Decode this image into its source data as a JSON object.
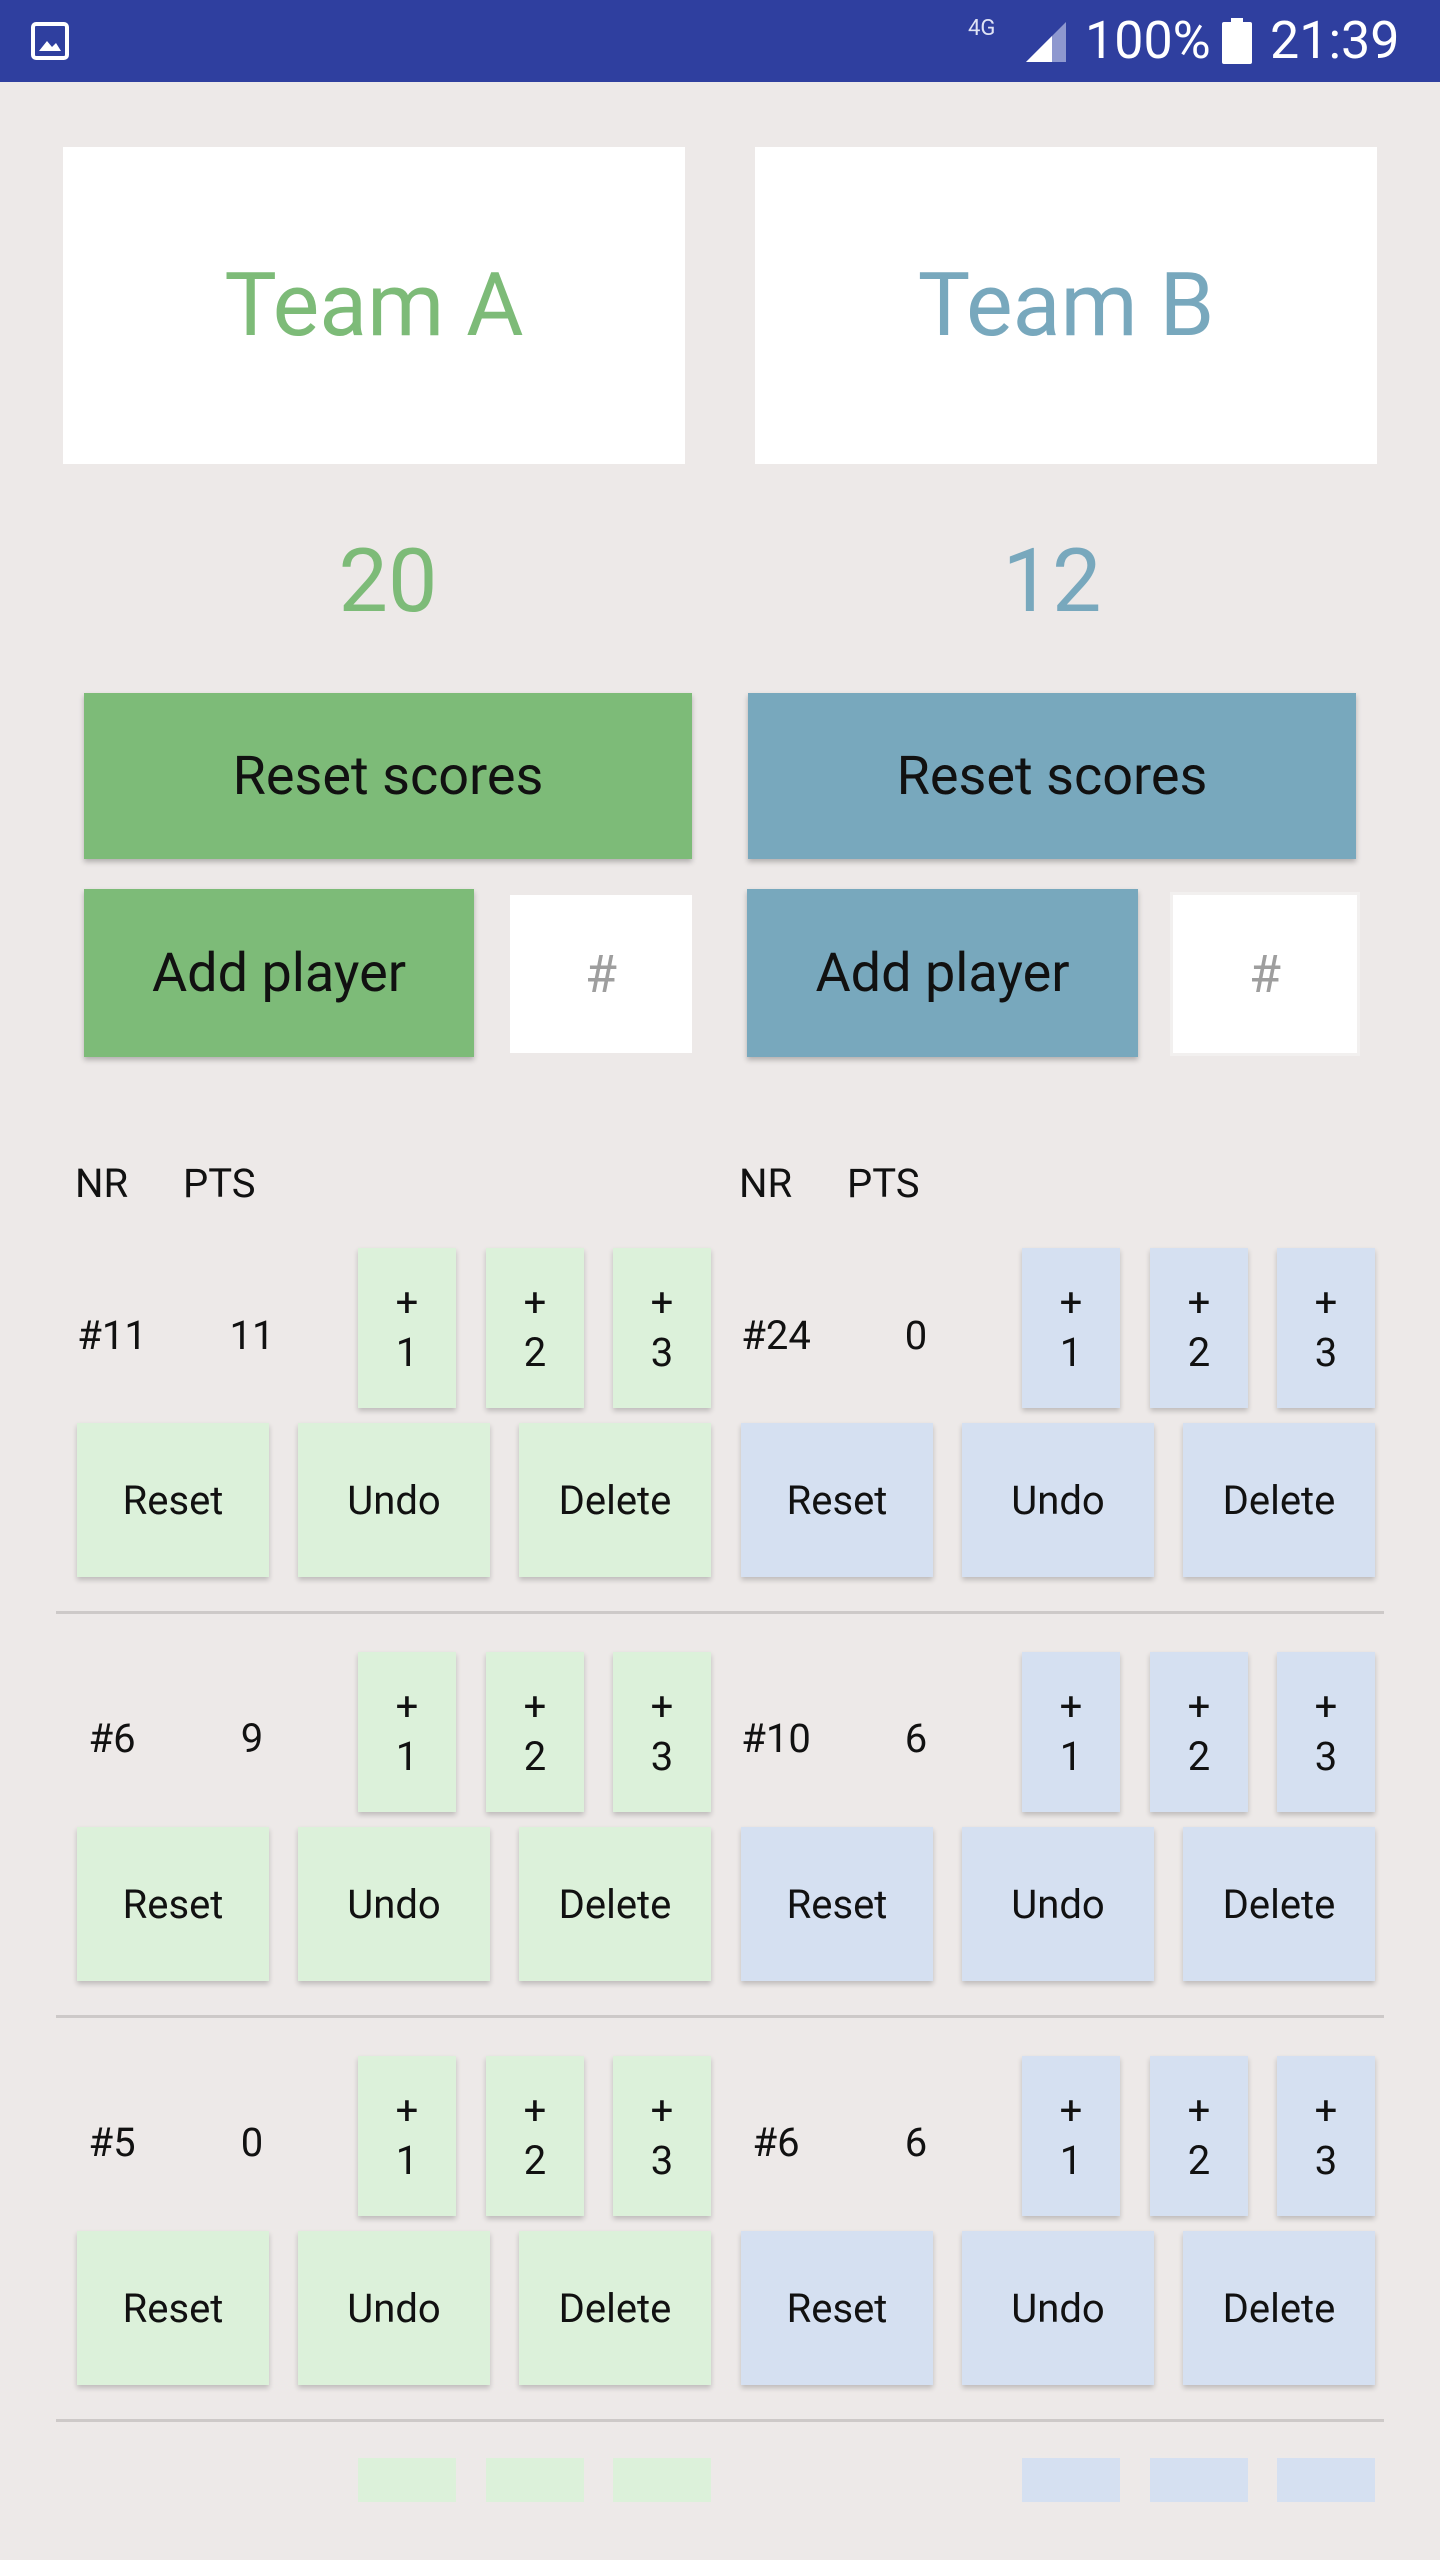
{
  "status_bar": {
    "network": "4G",
    "battery": "100%",
    "time": "21:39"
  },
  "team_a": {
    "name": "Team A",
    "score": "20",
    "reset_label": "Reset scores",
    "add_player_label": "Add player",
    "number_placeholder": "#",
    "color": "#7dbb78",
    "players": [
      {
        "nr": "#11",
        "pts": "11"
      },
      {
        "nr": "#6",
        "pts": "9"
      },
      {
        "nr": "#5",
        "pts": "0"
      }
    ]
  },
  "team_b": {
    "name": "Team B",
    "score": "12",
    "reset_label": "Reset scores",
    "add_player_label": "Add player",
    "number_placeholder": "#",
    "color": "#78a8bd",
    "players": [
      {
        "nr": "#24",
        "pts": "0"
      },
      {
        "nr": "#10",
        "pts": "6"
      },
      {
        "nr": "#6",
        "pts": "6"
      }
    ]
  },
  "table": {
    "col_nr": "NR",
    "col_pts": "PTS"
  },
  "buttons": {
    "plus": "+",
    "one": "1",
    "two": "2",
    "three": "3",
    "reset": "Reset",
    "undo": "Undo",
    "delete": "Delete"
  }
}
